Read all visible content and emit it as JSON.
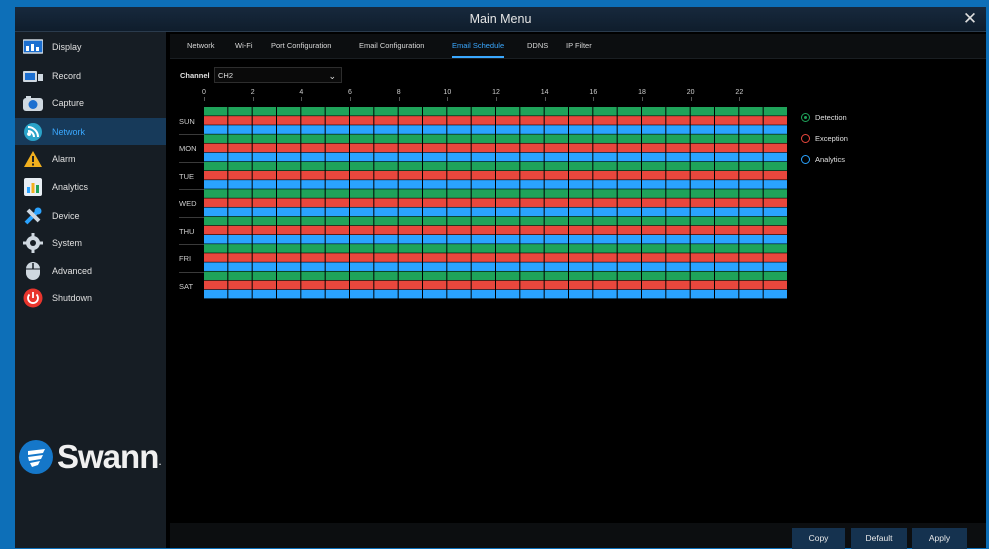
{
  "window": {
    "title": "Main Menu"
  },
  "sidebar": {
    "items": [
      {
        "label": "Display",
        "icon": "display-icon",
        "active": false
      },
      {
        "label": "Record",
        "icon": "record-icon",
        "active": false
      },
      {
        "label": "Capture",
        "icon": "capture-icon",
        "active": false
      },
      {
        "label": "Network",
        "icon": "network-icon",
        "active": true
      },
      {
        "label": "Alarm",
        "icon": "alarm-icon",
        "active": false
      },
      {
        "label": "Analytics",
        "icon": "analytics-icon",
        "active": false
      },
      {
        "label": "Device",
        "icon": "device-icon",
        "active": false
      },
      {
        "label": "System",
        "icon": "system-icon",
        "active": false
      },
      {
        "label": "Advanced",
        "icon": "advanced-icon",
        "active": false
      },
      {
        "label": "Shutdown",
        "icon": "shutdown-icon",
        "active": false
      }
    ],
    "logo_text": "Swann",
    "logo_suffix": "."
  },
  "tabs": [
    {
      "label": "Network",
      "active": false
    },
    {
      "label": "Wi-Fi",
      "active": false
    },
    {
      "label": "Port Configuration",
      "active": false
    },
    {
      "label": "Email Configuration",
      "active": false
    },
    {
      "label": "Email Schedule",
      "active": true
    },
    {
      "label": "DDNS",
      "active": false
    },
    {
      "label": "IP Filter",
      "active": false
    }
  ],
  "channel": {
    "label": "Channel",
    "value": "CH2"
  },
  "schedule": {
    "hour_labels": [
      "0",
      "2",
      "4",
      "6",
      "8",
      "10",
      "12",
      "14",
      "16",
      "18",
      "20",
      "22"
    ],
    "days": [
      "SUN",
      "MON",
      "TUE",
      "WED",
      "THU",
      "FRI",
      "SAT"
    ],
    "rows": [
      "Detection",
      "Exception",
      "Analytics"
    ],
    "hours_per_day": 24,
    "all_enabled": true
  },
  "legend": [
    {
      "label": "Detection",
      "color": "#1fa35a",
      "selected": true
    },
    {
      "label": "Exception",
      "color": "#e8473d",
      "selected": false
    },
    {
      "label": "Analytics",
      "color": "#2aa3ff",
      "selected": false
    }
  ],
  "buttons": {
    "copy": "Copy",
    "default": "Default",
    "apply": "Apply"
  },
  "colors": {
    "detection": "#1fa35a",
    "exception": "#e8473d",
    "analytics": "#2aa3ff",
    "accent": "#3aa8ff"
  }
}
